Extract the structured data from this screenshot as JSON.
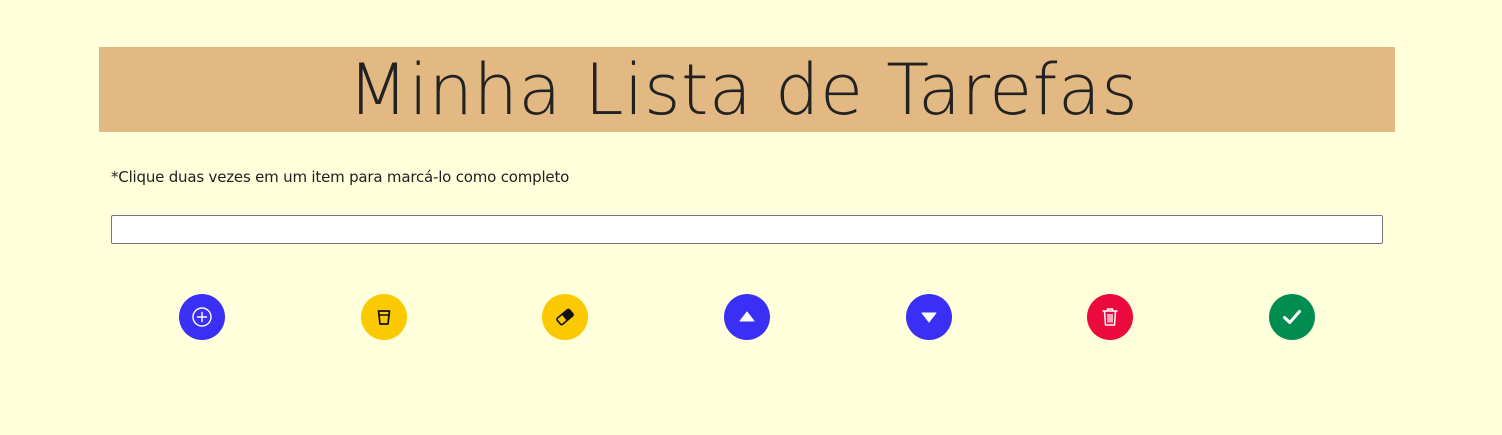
{
  "header": {
    "title": "Minha Lista de Tarefas"
  },
  "hint": {
    "text": "*Clique duas vezes em um item para marcá-lo como completo"
  },
  "task_input": {
    "value": "",
    "placeholder": ""
  },
  "toolbar": {
    "buttons": [
      {
        "id": "add",
        "icon": "plus-circle-icon",
        "color": "#3a2ff5"
      },
      {
        "id": "clear-completed",
        "icon": "cup-icon",
        "color": "#fbc902"
      },
      {
        "id": "clear-all",
        "icon": "eraser-icon",
        "color": "#fbc902"
      },
      {
        "id": "move-up",
        "icon": "caret-up-icon",
        "color": "#3a2ff5"
      },
      {
        "id": "move-down",
        "icon": "caret-down-icon",
        "color": "#3a2ff5"
      },
      {
        "id": "delete-selected",
        "icon": "trash-icon",
        "color": "#ea0a3d"
      },
      {
        "id": "save",
        "icon": "check-icon",
        "color": "#008d4f"
      }
    ]
  },
  "colors": {
    "background": "#ffffdb",
    "header": "#e2b983"
  }
}
